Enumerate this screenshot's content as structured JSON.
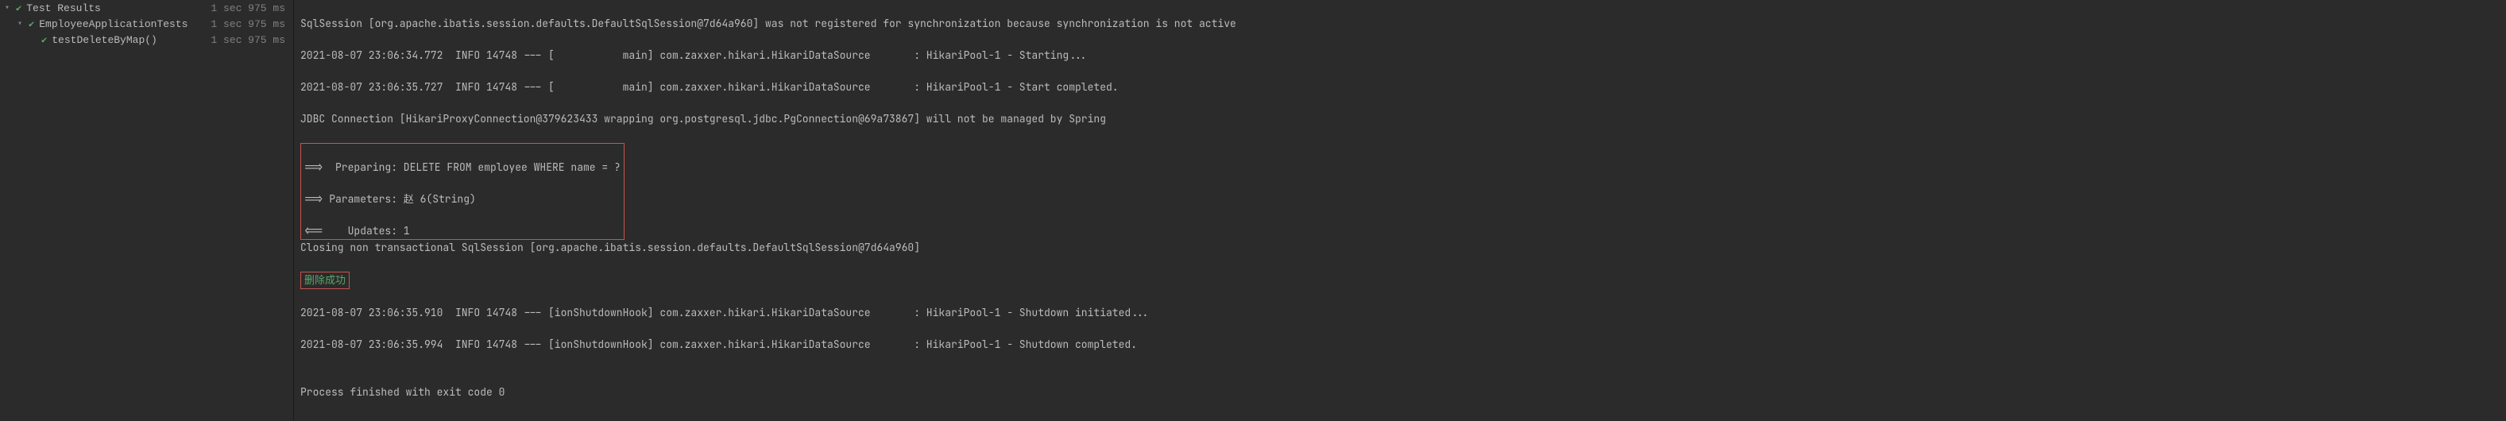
{
  "sidebar": {
    "items": [
      {
        "label": "Test Results",
        "timing": "1 sec 975 ms",
        "level": 0,
        "expanded": true
      },
      {
        "label": "EmployeeApplicationTests",
        "timing": "1 sec 975 ms",
        "level": 1,
        "expanded": true
      },
      {
        "label": "testDeleteByMap()",
        "timing": "1 sec 975 ms",
        "level": 2,
        "expanded": false
      }
    ]
  },
  "console": {
    "lines": {
      "l0": "SqlSession [org.apache.ibatis.session.defaults.DefaultSqlSession@7d64a960] was not registered for synchronization because synchronization is not active",
      "l1": "2021-08-07 23:06:34.772  INFO 14748 --- [           main] com.zaxxer.hikari.HikariDataSource       : HikariPool-1 - Starting...",
      "l2": "2021-08-07 23:06:35.727  INFO 14748 --- [           main] com.zaxxer.hikari.HikariDataSource       : HikariPool-1 - Start completed.",
      "l3": "JDBC Connection [HikariProxyConnection@379623433 wrapping org.postgresql.jdbc.PgConnection@69a73867] will not be managed by Spring",
      "b1": "==>  Preparing: DELETE FROM employee WHERE name = ?",
      "b2": "==> Parameters: 赵 6(String)",
      "b3": "<==    Updates: 1",
      "l4": "Closing non transactional SqlSession [org.apache.ibatis.session.defaults.DefaultSqlSession@7d64a960]",
      "success": "删除成功",
      "l5": "2021-08-07 23:06:35.910  INFO 14748 --- [ionShutdownHook] com.zaxxer.hikari.HikariDataSource       : HikariPool-1 - Shutdown initiated...",
      "l6": "2021-08-07 23:06:35.994  INFO 14748 --- [ionShutdownHook] com.zaxxer.hikari.HikariDataSource       : HikariPool-1 - Shutdown completed.",
      "blank": "",
      "exit": "Process finished with exit code 0"
    }
  }
}
